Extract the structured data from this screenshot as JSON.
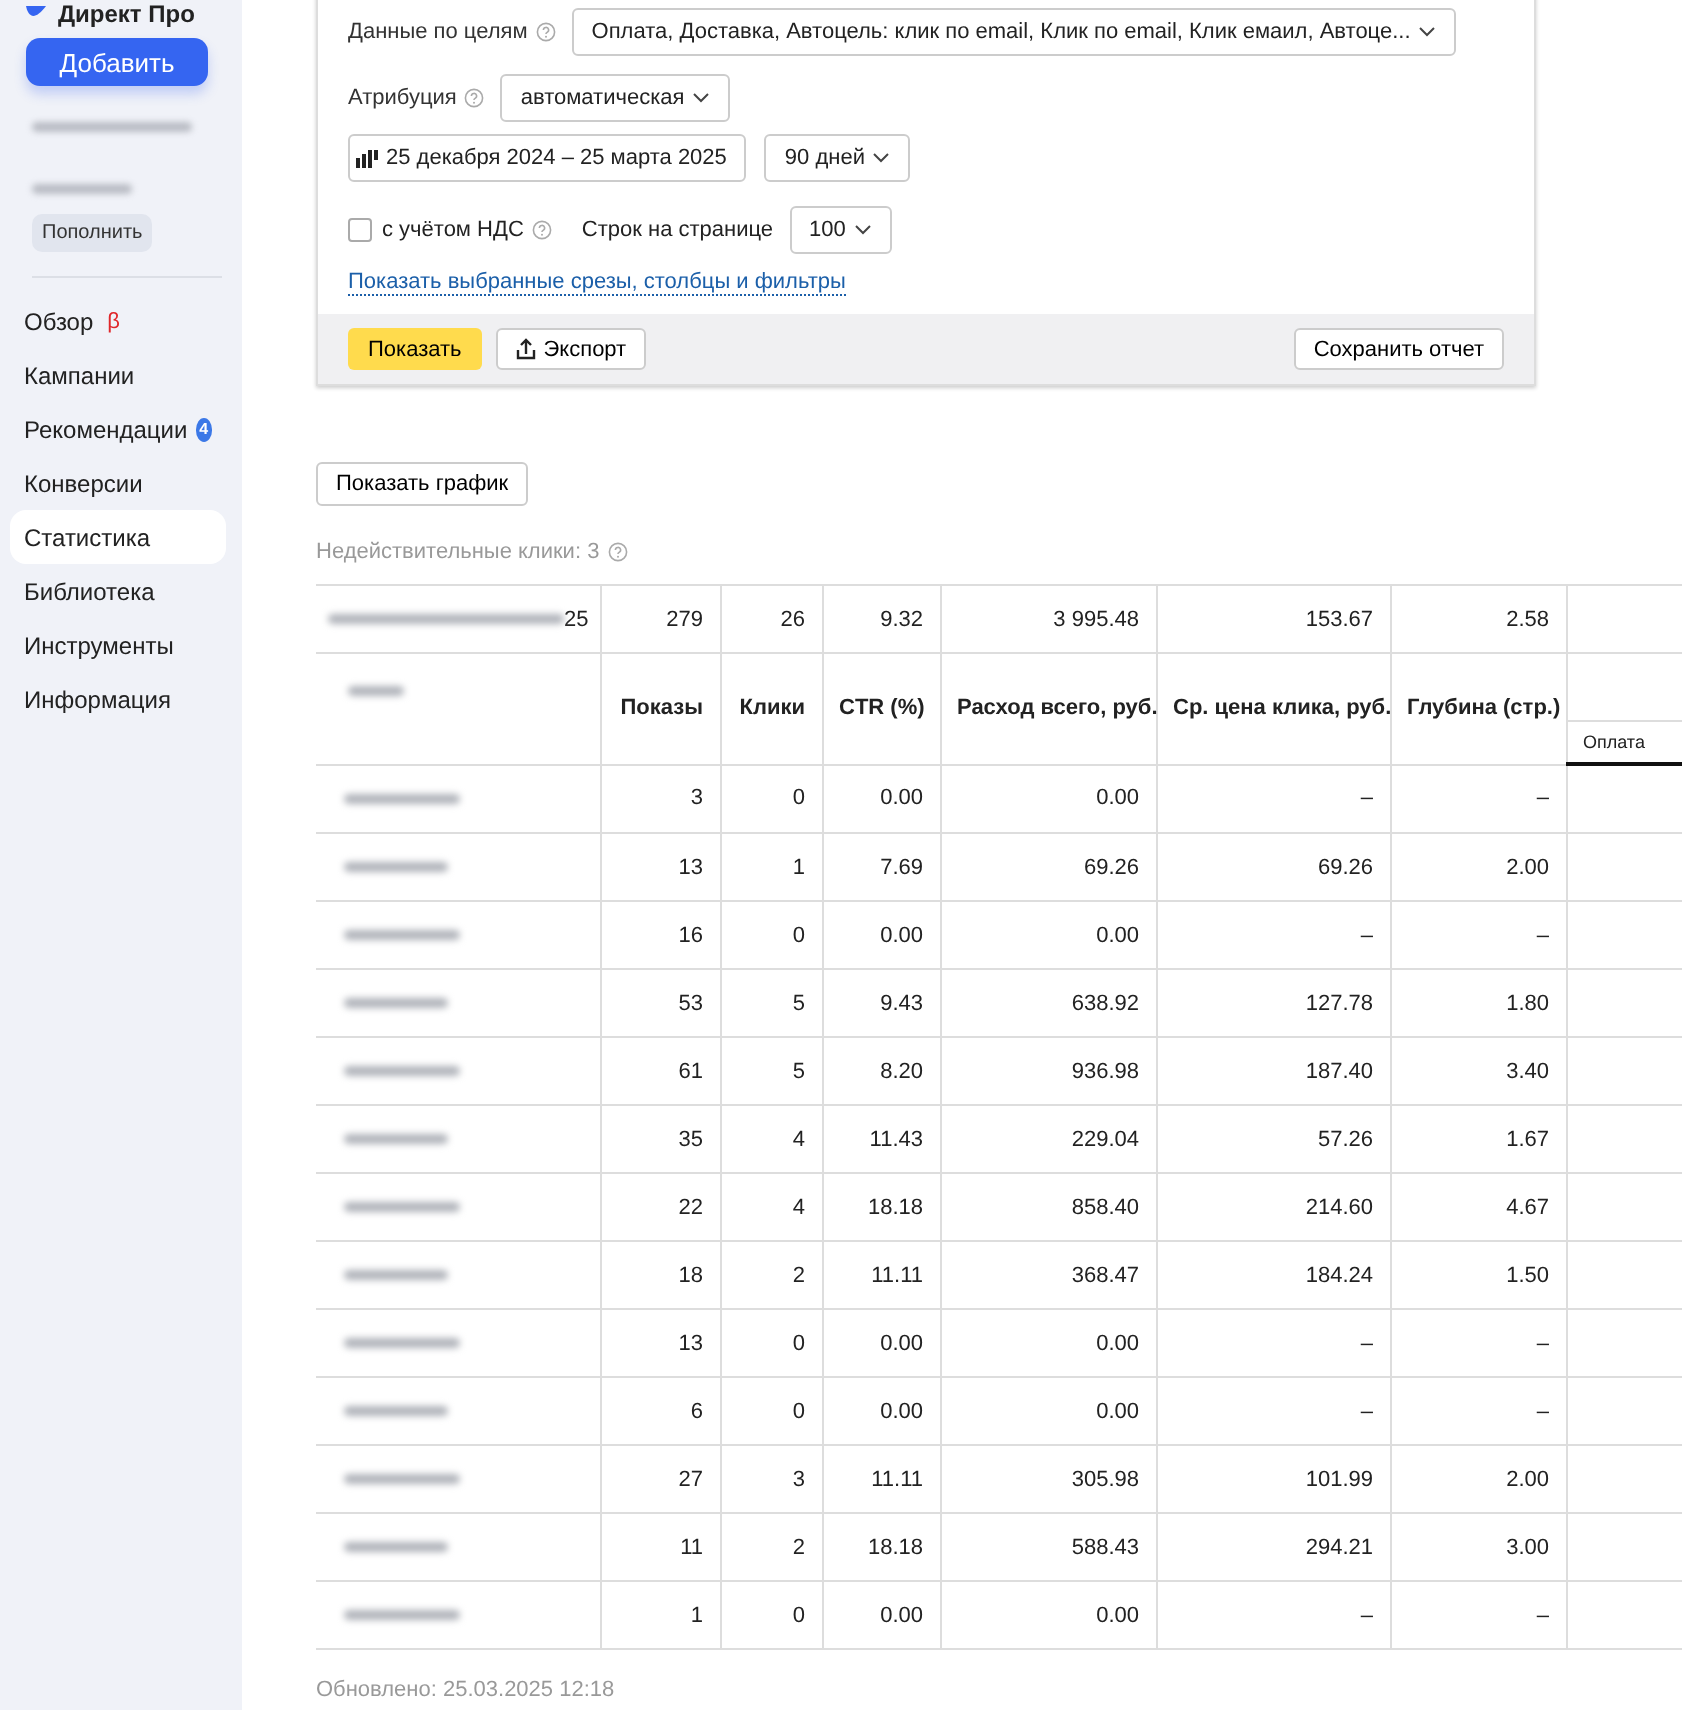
{
  "sidebar": {
    "logo": "Директ Про",
    "add_button": "Добавить",
    "topup_button": "Пополнить",
    "items": [
      {
        "label": "Обзор",
        "mark": "β",
        "selected": false
      },
      {
        "label": "Кампании",
        "selected": false
      },
      {
        "label": "Рекомендации",
        "badge": "4",
        "selected": false
      },
      {
        "label": "Конверсии",
        "selected": false
      },
      {
        "label": "Статистика",
        "selected": true
      },
      {
        "label": "Библиотека",
        "selected": false
      },
      {
        "label": "Инструменты",
        "selected": false
      },
      {
        "label": "Информация",
        "selected": false
      }
    ]
  },
  "filters": {
    "goals": {
      "label": "Данные по целям",
      "value": "Оплата, Доставка, Автоцель: клик по email, Клик по email, Клик емаил, Автоце..."
    },
    "attribution": {
      "label": "Атрибуция",
      "value": "автоматическая"
    },
    "date_range": "25 декабря 2024 – 25 марта 2025",
    "period": "90 дней",
    "vat": {
      "label": "с учётом НДС",
      "checked": false
    },
    "rows_per_page": {
      "label": "Строк на странице",
      "value": "100"
    },
    "link": "Показать выбранные срезы, столбцы и фильтры",
    "show_button": "Показать",
    "export_button": "Экспорт",
    "save_button": "Сохранить отчет"
  },
  "chart_button": "Показать график",
  "invalid_clicks": "Недействительные клики: 3",
  "table": {
    "columns": [
      "Показы",
      "Клики",
      "CTR (%)",
      "Расход всего, руб.",
      "Ср. цена клика, руб.",
      "Глубина (стр.)"
    ],
    "goal_columns": [
      "Оплата"
    ],
    "total": {
      "name_tail": "25",
      "values": [
        "279",
        "26",
        "9.32",
        "3 995.48",
        "153.67",
        "2.58"
      ]
    },
    "rows": [
      [
        "3",
        "0",
        "0.00",
        "0.00",
        "–",
        "–"
      ],
      [
        "13",
        "1",
        "7.69",
        "69.26",
        "69.26",
        "2.00"
      ],
      [
        "16",
        "0",
        "0.00",
        "0.00",
        "–",
        "–"
      ],
      [
        "53",
        "5",
        "9.43",
        "638.92",
        "127.78",
        "1.80"
      ],
      [
        "61",
        "5",
        "8.20",
        "936.98",
        "187.40",
        "3.40"
      ],
      [
        "35",
        "4",
        "11.43",
        "229.04",
        "57.26",
        "1.67"
      ],
      [
        "22",
        "4",
        "18.18",
        "858.40",
        "214.60",
        "4.67"
      ],
      [
        "18",
        "2",
        "11.11",
        "368.47",
        "184.24",
        "1.50"
      ],
      [
        "13",
        "0",
        "0.00",
        "0.00",
        "–",
        "–"
      ],
      [
        "6",
        "0",
        "0.00",
        "0.00",
        "–",
        "–"
      ],
      [
        "27",
        "3",
        "11.11",
        "305.98",
        "101.99",
        "2.00"
      ],
      [
        "11",
        "2",
        "18.18",
        "588.43",
        "294.21",
        "3.00"
      ],
      [
        "1",
        "0",
        "0.00",
        "0.00",
        "–",
        "–"
      ]
    ]
  },
  "updated": "Обновлено: 25.03.2025 12:18"
}
